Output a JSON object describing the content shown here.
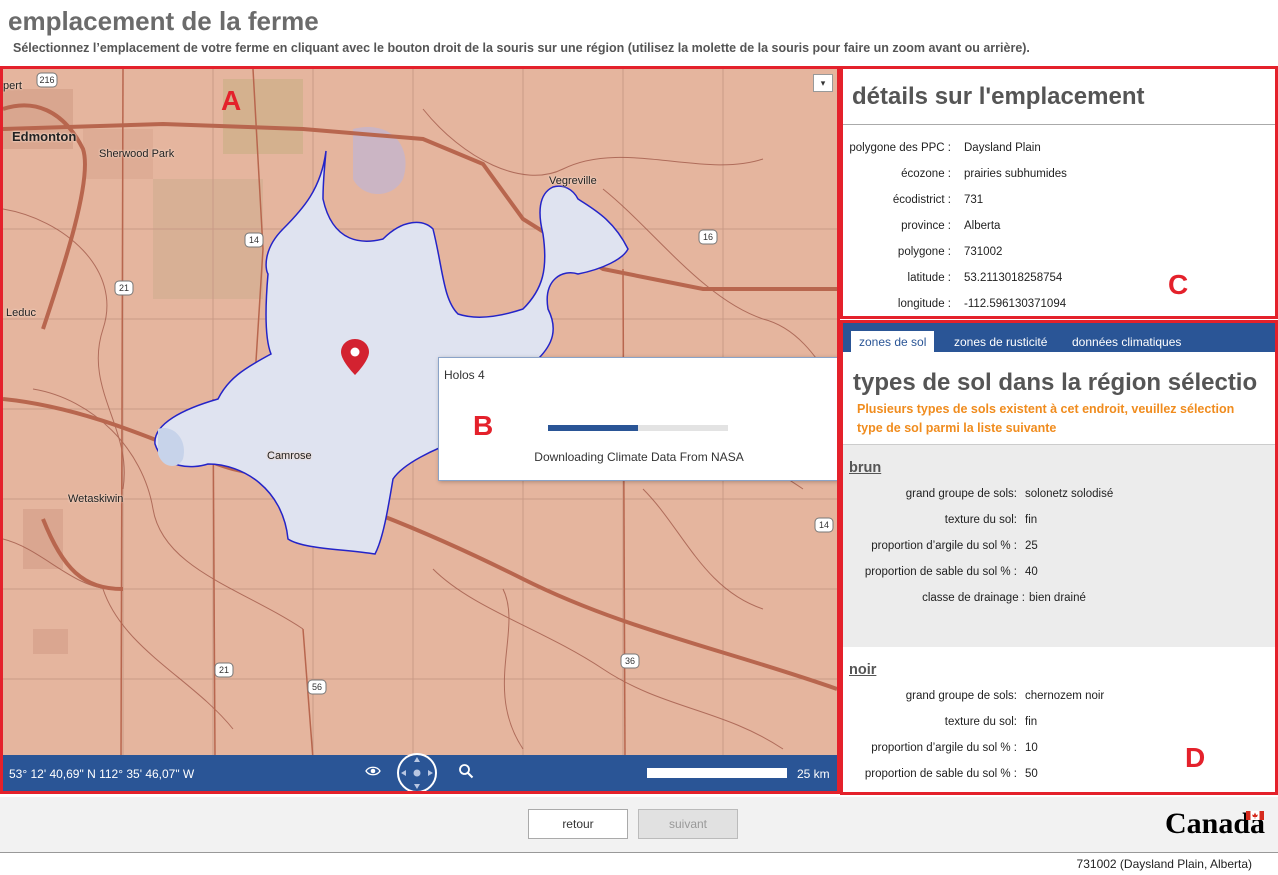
{
  "header": {
    "title": "emplacement de la ferme",
    "subtitle": "Sélectionnez l’emplacement de votre ferme en cliquant avec le bouton droit de la souris sur une région (utilisez la molette de la souris pour faire un zoom avant ou arrière)."
  },
  "map": {
    "panel_letter": "A",
    "dropdown_glyph": "▾",
    "places": {
      "edmonton": "Edmonton",
      "sherwood_park": "Sherwood Park",
      "vegreville": "Vegreville",
      "leduc": "Leduc",
      "camrose": "Camrose",
      "wetaskiwin": "Wetaskiwin",
      "beaumont_partial": "pert"
    },
    "highway_shields": {
      "h216": "216",
      "h14a": "14",
      "h16": "16",
      "h21a": "21",
      "h14b": "14",
      "h21b": "21",
      "h56": "56",
      "h36": "36"
    },
    "footer": {
      "coordinates": "53° 12' 40,69\" N 112° 35' 46,07\" W",
      "scale_label": "25 km"
    },
    "colors": {
      "land": "#e5b59e",
      "polygon_fill": "#dfe3f0",
      "polygon_stroke": "#2424c8",
      "marker": "#d32230"
    }
  },
  "dialog": {
    "panel_letter": "B",
    "title": "Holos 4",
    "progress_fraction": 0.5,
    "status": "Downloading Climate Data From NASA"
  },
  "details": {
    "panel_letter": "C",
    "title": "détails sur l'emplacement",
    "rows": [
      {
        "label": "polygone des PPC :",
        "value": "Daysland Plain"
      },
      {
        "label": "écozone :",
        "value": "prairies subhumides"
      },
      {
        "label": "écodistrict :",
        "value": "731"
      },
      {
        "label": "province :",
        "value": "Alberta"
      },
      {
        "label": "polygone :",
        "value": "731002"
      },
      {
        "label": "latitude :",
        "value": "53.2113018258754"
      },
      {
        "label": "longitude :",
        "value": "-112.596130371094"
      }
    ]
  },
  "soil": {
    "panel_letter": "D",
    "tabs": [
      "zones de sol",
      "zones de rusticité",
      "données climatiques"
    ],
    "active_tab": "zones de sol",
    "title": "types de sol dans la région sélectio",
    "warning_line1": "Plusieurs types de sols existent à cet endroit, veuillez sélection",
    "warning_line2": "type de sol parmi la liste suivante",
    "types": [
      {
        "name": "brun",
        "rows": [
          {
            "label": "grand groupe de sols:",
            "value": "solonetz solodisé"
          },
          {
            "label": "texture du sol:",
            "value": "fin"
          },
          {
            "label": "proportion d’argile du sol % :",
            "value": "25"
          },
          {
            "label": "proportion de sable du sol % :",
            "value": "40"
          },
          {
            "label": "classe de drainage :",
            "value": "bien drainé"
          }
        ]
      },
      {
        "name": "noir",
        "rows": [
          {
            "label": "grand groupe de sols:",
            "value": "chernozem noir"
          },
          {
            "label": "texture du sol:",
            "value": "fin"
          },
          {
            "label": "proportion d’argile du sol % :",
            "value": "10"
          },
          {
            "label": "proportion de sable du sol % :",
            "value": "50"
          }
        ]
      }
    ]
  },
  "navigation": {
    "back_label": "retour",
    "next_label": "suivant"
  },
  "branding": {
    "wordmark": "Canada"
  },
  "status_bar": {
    "text": "731002 (Daysland Plain, Alberta)"
  }
}
